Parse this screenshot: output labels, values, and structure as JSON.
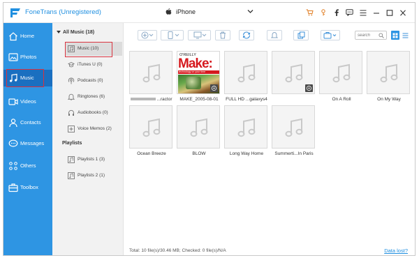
{
  "app": {
    "title": "FoneTrans (Unregistered)",
    "device": "iPhone"
  },
  "window_controls": [
    "cart-icon",
    "key-icon",
    "facebook-icon",
    "feedback-icon",
    "menu-icon",
    "minimize-icon",
    "maximize-icon",
    "close-icon"
  ],
  "sidebar": {
    "items": [
      {
        "label": "Home",
        "icon": "home-icon"
      },
      {
        "label": "Photos",
        "icon": "photos-icon"
      },
      {
        "label": "Music",
        "icon": "music-icon",
        "active": true
      },
      {
        "label": "Videos",
        "icon": "videos-icon"
      },
      {
        "label": "Contacts",
        "icon": "contacts-icon"
      },
      {
        "label": "Messages",
        "icon": "messages-icon"
      },
      {
        "label": "Others",
        "icon": "others-icon"
      },
      {
        "label": "Toolbox",
        "icon": "toolbox-icon"
      }
    ]
  },
  "categories": {
    "all_music": "All Music (18)",
    "items": [
      {
        "label": "Music (10)",
        "active": true
      },
      {
        "label": "iTunes U (0)"
      },
      {
        "label": "Podcasts (0)"
      },
      {
        "label": "Ringtones (6)"
      },
      {
        "label": "Audiobooks (0)"
      },
      {
        "label": "Voice Memos (2)"
      }
    ],
    "playlists_header": "Playlists",
    "playlists": [
      {
        "label": "Playlists 1 (3)"
      },
      {
        "label": "Playlists 2 (1)"
      }
    ]
  },
  "toolbar": {
    "search_placeholder": "search"
  },
  "tracks": [
    {
      "name": "...ractor",
      "blurred_prefix": true,
      "cover": false,
      "badge": false
    },
    {
      "name": "MAKE_2005-08-01",
      "cover": true,
      "badge": true
    },
    {
      "name": "FULL HD ...galaxys4",
      "cover": false,
      "badge": false
    },
    {
      "name": "",
      "cover": false,
      "badge": true
    },
    {
      "name": "On A Roll",
      "cover": false,
      "badge": false
    },
    {
      "name": "On My Way",
      "cover": false,
      "badge": false
    },
    {
      "name": "Ocean Breeze",
      "cover": false,
      "badge": false
    },
    {
      "name": "BLOW",
      "cover": false,
      "badge": false
    },
    {
      "name": "Long Way Home",
      "cover": false,
      "badge": false
    },
    {
      "name": "Summerti...In Paris",
      "cover": false,
      "badge": false
    }
  ],
  "cover_art": {
    "publisher": "O'REILLY",
    "brand": "Make:",
    "tagline": "technology on your time"
  },
  "status": {
    "text": "Total: 10 file(s)/30.46 MB; Checked: 0 file(s)/N/A",
    "data_lost": "Data lost?"
  },
  "colors": {
    "accent": "#2e95e3",
    "active_nav": "#1a6fc0",
    "highlight": "#d9333f",
    "link": "#1f8fe0"
  }
}
